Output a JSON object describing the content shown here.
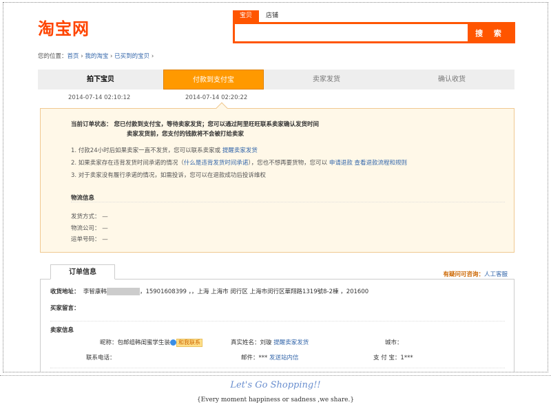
{
  "logo": "淘宝网",
  "search": {
    "tabs": [
      "宝贝",
      "店铺"
    ],
    "button": "搜 索",
    "value": ""
  },
  "breadcrumb": {
    "prefix": "您的位置：",
    "items": [
      "首页",
      "我的淘宝",
      "已买到的宝贝"
    ],
    "sep": " › "
  },
  "steps": [
    "拍下宝贝",
    "付款到支付宝",
    "卖家发货",
    "确认收货"
  ],
  "times": [
    "2014-07-14 02:10:12",
    "2014-07-14 02:20:22"
  ],
  "notice": {
    "status_line1": "当前订单状态：  您已付款到支付宝，等待卖家发货；您可以通过阿里旺旺联系卖家确认发货时间",
    "status_line2": "卖家发货前，您支付的钱款将不会被打给卖家",
    "item1_text": "1. 付款24小时后如果卖家一直不发货，您可以联系卖家或 ",
    "item1_link": "提醒卖家发货",
    "item2_text": "2. 如果卖家存在违背发货时间承诺的情况（",
    "item2_link1": "什么是违背发货时间承诺",
    "item2_mid": "），您也不想再要货物，您可以 ",
    "item2_link2": "申请退款",
    "item2_link3": "查看退款流程和规则",
    "item3_text": "3. 对于卖家没有履行承诺的情况，如需投诉，您可以在退款成功后投诉维权",
    "logistics_title": "物流信息",
    "ship_method": "发货方式：  —",
    "ship_company": "物流公司：  —",
    "ship_number": "运单号码：  —"
  },
  "order": {
    "tab": "订单信息",
    "help_label": "有疑问可咨询：",
    "help_link": "人工客服",
    "addr_label": "收货地址：",
    "addr_name": "李智康韩",
    "addr_rest": "，15901608399 ，，上海 上海市 闵行区 上海市闵行区華翔路1319號8-2棟 ，201600",
    "msg_label": "买家留言：",
    "seller_title": "卖家信息",
    "nick_label": "昵称：",
    "nick_value": "包邮组韩闺蜜学生装",
    "ww_label": "和我联系",
    "realname_label": "真实姓名：",
    "realname_value": "刘璇",
    "realname_link": "提醒卖家发货",
    "city_label": "城市：",
    "phone_label": "联系电话：",
    "mail_label": "邮件：",
    "mail_value": "***",
    "mail_link": "发送站内信",
    "alipay_label": "支 付 宝：",
    "alipay_value": "1***"
  },
  "footer": {
    "line1": "Let's Go Shopping!!",
    "line2": "{Every moment happiness or sadness ,we share.}"
  }
}
